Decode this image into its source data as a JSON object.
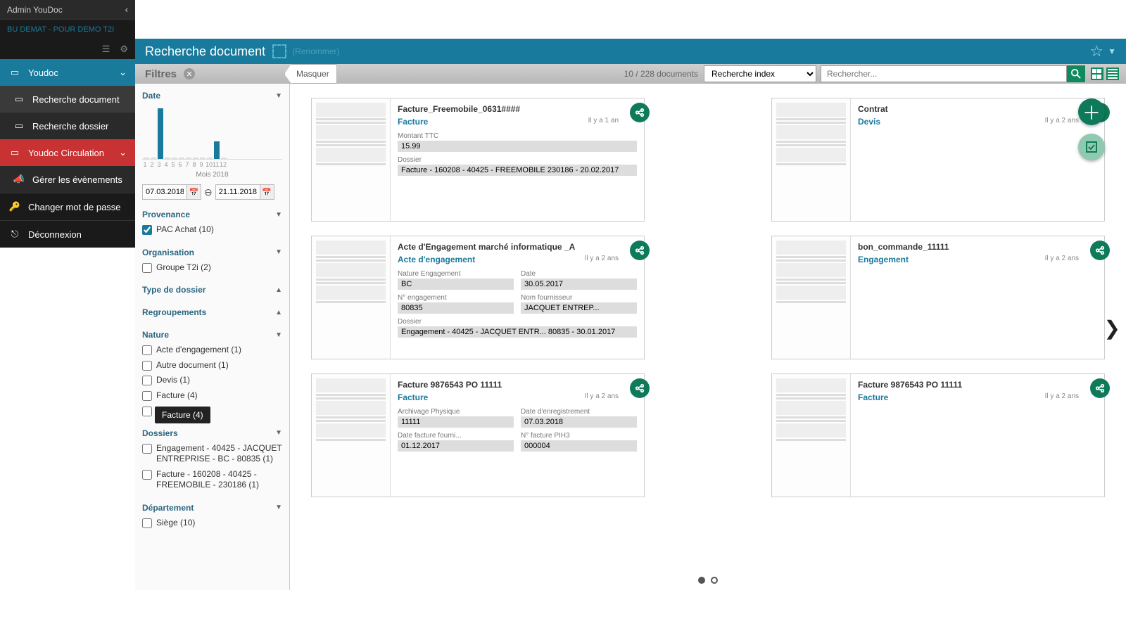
{
  "leftnav": {
    "admin": "Admin YouDoc",
    "bu": "BU DEMAT - POUR DEMO T2I",
    "items": {
      "youdoc": "Youdoc",
      "recherche_doc": "Recherche document",
      "recherche_dossier": "Recherche dossier",
      "circulation": "Youdoc Circulation",
      "evenements": "Gérer les évènements"
    },
    "bottom": {
      "change_pwd": "Changer mot de passe",
      "logout": "Déconnexion"
    }
  },
  "header": {
    "title": "Recherche document",
    "subtitle": "(Renommer)"
  },
  "toolbar": {
    "filtres": "Filtres",
    "masquer": "Masquer",
    "count": "10 / 228 documents",
    "search_mode": "Recherche index",
    "search_placeholder": "Rechercher..."
  },
  "filters": {
    "date": {
      "label": "Date",
      "month": "Mois 2018",
      "from": "07.03.2018",
      "to": "21.11.2018",
      "ticks": [
        "1",
        "2",
        "3",
        "4",
        "5",
        "6",
        "7",
        "8",
        "9",
        "10",
        "11",
        "12"
      ]
    },
    "provenance": {
      "label": "Provenance",
      "items": [
        "PAC Achat (10)"
      ]
    },
    "organisation": {
      "label": "Organisation",
      "items": [
        "Groupe T2i (2)"
      ]
    },
    "type_dossier": {
      "label": "Type de dossier"
    },
    "regroupements": {
      "label": "Regroupements"
    },
    "nature": {
      "label": "Nature",
      "items": [
        "Acte d'engagement (1)",
        "Autre document (1)",
        "Devis (1)",
        "Facture (4)",
        ""
      ]
    },
    "tooltip": "Facture (4)",
    "dossiers": {
      "label": "Dossiers",
      "items": [
        "Engagement - 40425 - JACQUET ENTREPRISE - BC - 80835 (1)",
        "Facture - 160208 - 40425 - FREEMOBILE - 230186 (1)"
      ]
    },
    "departement": {
      "label": "Département",
      "items": [
        "Siège (10)"
      ]
    }
  },
  "cards": [
    {
      "title": "Facture_Freemobile_0631####",
      "type": "Facture",
      "time": "Il y a 1 an",
      "fields": [
        {
          "label": "Montant TTC",
          "value": "15.99"
        }
      ],
      "dossier_label": "Dossier",
      "dossier": "Facture - 160208 - 40425 - FREEMOBILE 230186 - 20.02.2017"
    },
    {
      "title": "Contrat",
      "type": "Devis",
      "time": "Il y a 2 ans"
    },
    {
      "title": "Acte d'Engagement marché informatique _A",
      "type": "Acte d'engagement",
      "time": "Il y a 2 ans",
      "fields": [
        {
          "label": "Nature Engagement",
          "value": "BC"
        },
        {
          "label": "Date",
          "value": "30.05.2017"
        },
        {
          "label": "N° engagement",
          "value": "80835"
        },
        {
          "label": "Nom fournisseur",
          "value": "JACQUET ENTREP..."
        }
      ],
      "dossier_label": "Dossier",
      "dossier": "Engagement - 40425 - JACQUET ENTR... 80835 - 30.01.2017"
    },
    {
      "title": "bon_commande_11111",
      "type": "Engagement",
      "time": "Il y a 2 ans"
    },
    {
      "title": "Facture 9876543 PO 11111",
      "type": "Facture",
      "time": "Il y a 2 ans",
      "fields": [
        {
          "label": "Archivage Physique",
          "value": "11111"
        },
        {
          "label": "Date d'enregistrement",
          "value": "07.03.2018"
        },
        {
          "label": "Date facture fourni...",
          "value": "01.12.2017"
        },
        {
          "label": "N° facture PIH3",
          "value": "000004"
        }
      ]
    },
    {
      "title": "Facture 9876543 PO 11111",
      "type": "Facture",
      "time": "Il y a 2 ans"
    }
  ],
  "chart_data": {
    "type": "bar",
    "categories": [
      "1",
      "2",
      "3",
      "4",
      "5",
      "6",
      "7",
      "8",
      "9",
      "10",
      "11",
      "12"
    ],
    "values": [
      0,
      0,
      6,
      0,
      0,
      0,
      0,
      0,
      0,
      0,
      2,
      0
    ],
    "xlabel": "Mois 2018"
  }
}
